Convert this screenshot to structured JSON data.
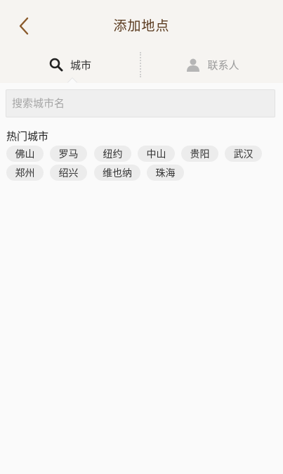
{
  "header": {
    "title": "添加地点",
    "back_icon": "chevron-left-icon",
    "accent_color": "#8a5a2b"
  },
  "tabs": [
    {
      "label": "城市",
      "icon": "search-icon",
      "active": true
    },
    {
      "label": "联系人",
      "icon": "person-icon",
      "active": false
    }
  ],
  "search": {
    "placeholder": "搜索城市名",
    "value": ""
  },
  "hot_cities": {
    "title": "热门城市",
    "items": [
      "佛山",
      "罗马",
      "纽约",
      "中山",
      "贵阳",
      "武汉",
      "郑州",
      "绍兴",
      "维也纳",
      "珠海"
    ]
  }
}
